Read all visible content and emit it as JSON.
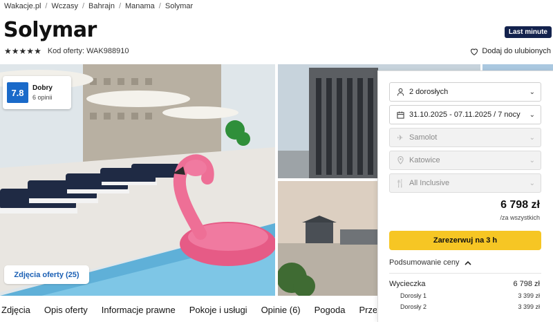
{
  "breadcrumb": [
    "Wakacje.pl",
    "Wczasy",
    "Bahrajn",
    "Manama",
    "Solymar"
  ],
  "hotel": {
    "name": "Solymar",
    "stars": 5,
    "offer_code": "Kod oferty: WAK988910",
    "last_minute": "Last minute",
    "favorite": "Dodaj do ulubionych"
  },
  "rating": {
    "score": "7.8",
    "label": "Dobry",
    "reviews": "6 opinii"
  },
  "gallery": {
    "photos_button": "Zdjęcia oferty (25)"
  },
  "tabs": [
    "Zdjęcia",
    "Opis oferty",
    "Informacje prawne",
    "Pokoje i usługi",
    "Opinie (6)",
    "Pogoda",
    "Przed p"
  ],
  "booking": {
    "travelers": "2 dorosłych",
    "dates": "31.10.2025 - 07.11.2025 / 7 nocy",
    "transport": "Samolot",
    "departure": "Katowice",
    "board": "All Inclusive",
    "price": "6 798 zł",
    "price_note": "/za wszystkich",
    "reserve_button": "Zarezerwuj na 3 h",
    "summary_toggle": "Podsumowanie ceny",
    "summary": {
      "trip_label": "Wycieczka",
      "trip_value": "6 798 zł",
      "items": [
        {
          "label": "Dorosły 1",
          "value": "3 399 zł"
        },
        {
          "label": "Dorosły 2",
          "value": "3 399 zł"
        }
      ]
    }
  },
  "colors": {
    "accent_blue": "#1a6ac9",
    "badge_navy": "#13224d",
    "reserve_yellow": "#f6c624"
  }
}
